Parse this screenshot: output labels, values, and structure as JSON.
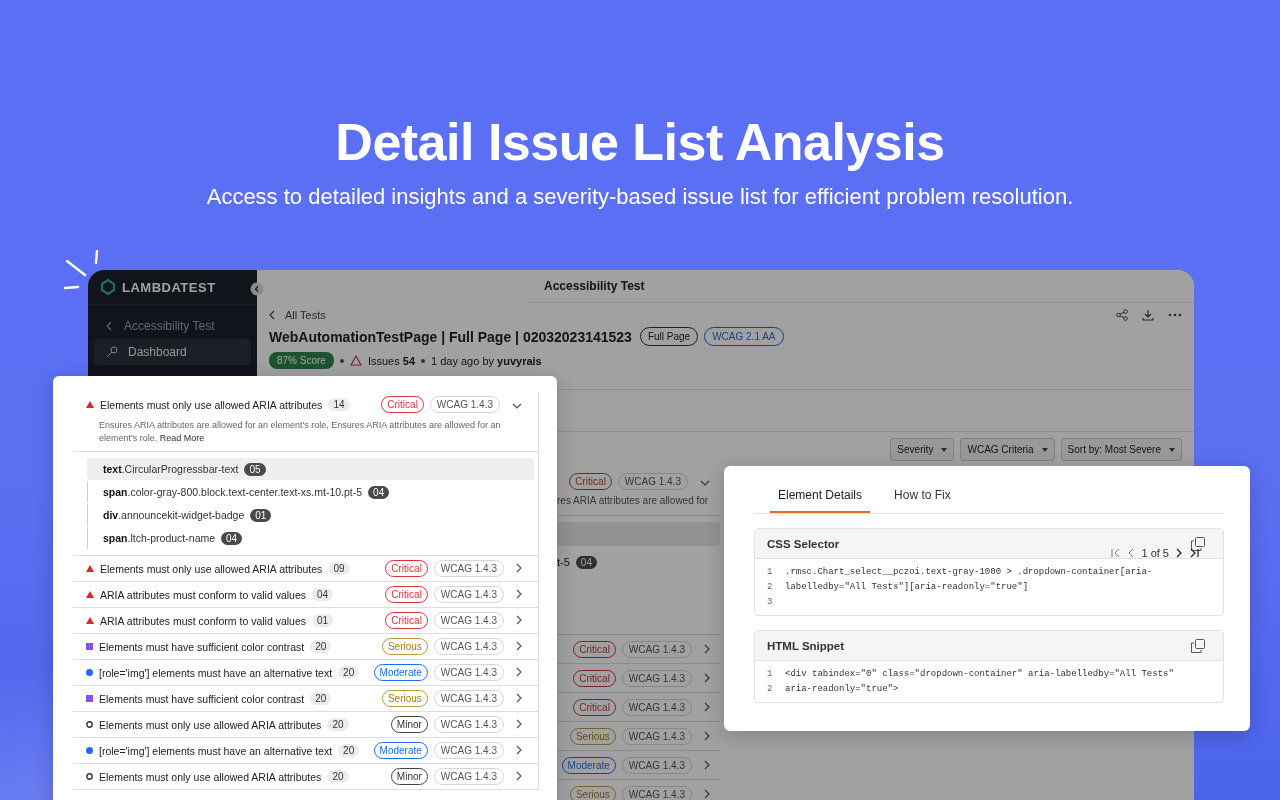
{
  "hero": {
    "title": "Detail Issue List Analysis",
    "subtitle": "Access to detailed insights and a severity-based issue list for efficient problem resolution."
  },
  "back_window": {
    "sidebar": {
      "logo": "LAMBDATEST",
      "back_label": "Accessibility Test",
      "items": [
        {
          "label": "Dashboard",
          "selected": true
        }
      ]
    },
    "header_title": "Accessibility Test",
    "breadcrumb": "All Tests",
    "test_title": "WebAutomationTestPage | Full Page | 02032023141523",
    "tags": [
      {
        "label": "Full Page",
        "kind": "neutral"
      },
      {
        "label": "WCAG 2.1 AA",
        "kind": "info"
      }
    ],
    "score": "87% Score",
    "issues_label": "Issues",
    "issues_count": "54",
    "meta": "1 day ago by",
    "author": "yuvyrais",
    "filters": [
      "Severity",
      "WCAG Criteria"
    ],
    "sort": {
      "label": "Sort by:",
      "value": "Most Severe"
    },
    "issues": [
      {
        "kind": "critical",
        "severity": "Critical",
        "wcag": "WCAG 1.4.3",
        "expanded": true,
        "description": "res ARIA attributes are allowed for",
        "children": [
          {
            "selected": true
          },
          {
            "selector": "t-5",
            "count": "04",
            "selected": false
          }
        ]
      },
      {
        "kind": "critical",
        "severity": "Critical",
        "wcag": "WCAG 1.4.3",
        "expanded": false
      },
      {
        "kind": "critical",
        "severity": "Critical",
        "wcag": "WCAG 1.4.3",
        "expanded": false
      },
      {
        "kind": "critical",
        "severity": "Critical",
        "wcag": "WCAG 1.4.3",
        "expanded": false
      },
      {
        "kind": "serious",
        "severity": "Serious",
        "wcag": "WCAG 1.4.3",
        "expanded": false
      },
      {
        "kind": "moderate",
        "severity": "Moderate",
        "wcag": "WCAG 1.4.3",
        "expanded": false
      },
      {
        "kind": "serious",
        "severity": "Serious",
        "wcag": "WCAG 1.4.3",
        "expanded": false
      }
    ]
  },
  "issue_panel": {
    "issues": [
      {
        "kind": "critical",
        "title": "Elements must only use allowed ARIA attributes",
        "count": "14",
        "severity": "Critical",
        "wcag": "WCAG 1.4.3",
        "expanded": true,
        "description": "Ensures ARIA attributes are allowed for an element's role, Ensures ARIA attributes are allowed for an element's role.",
        "read_more": "Read More",
        "children": [
          {
            "selector": "**text**.CircularProgressbar-text",
            "count": "05",
            "selected": true
          },
          {
            "selector": "**span**.color-gray-800.block.text-center.text-xs.mt-10.pt-5",
            "count": "04",
            "selected": false
          },
          {
            "selector": "**div**.announcekit-widget-badge",
            "count": "01",
            "selected": false
          },
          {
            "selector": "**span**.ltch-product-name",
            "count": "04",
            "selected": false
          }
        ]
      },
      {
        "kind": "critical",
        "title": "Elements must only use allowed ARIA attributes",
        "count": "09",
        "severity": "Critical",
        "wcag": "WCAG 1.4.3",
        "expanded": false
      },
      {
        "kind": "critical",
        "title": "ARIA attributes must conform to valid values",
        "count": "04",
        "severity": "Critical",
        "wcag": "WCAG 1.4.3",
        "expanded": false
      },
      {
        "kind": "critical",
        "title": "ARIA attributes must conform to valid values",
        "count": "01",
        "severity": "Critical",
        "wcag": "WCAG 1.4.3",
        "expanded": false
      },
      {
        "kind": "serious",
        "title": "Elements must have sufficient color contrast",
        "count": "20",
        "severity": "Serious",
        "wcag": "WCAG 1.4.3",
        "expanded": false
      },
      {
        "kind": "moderate",
        "title": "[role='img'] elements must have an alternative text",
        "count": "20",
        "severity": "Moderate",
        "wcag": "WCAG 1.4.3",
        "expanded": false
      },
      {
        "kind": "serious",
        "title": "Elements must have sufficient color contrast",
        "count": "20",
        "severity": "Serious",
        "wcag": "WCAG 1.4.3",
        "expanded": false
      },
      {
        "kind": "minor",
        "title": "Elements must only use allowed ARIA attributes",
        "count": "20",
        "severity": "Minor",
        "wcag": "WCAG 1.4.3",
        "expanded": false
      },
      {
        "kind": "moderate",
        "title": "[role='img'] elements must have an alternative text",
        "count": "20",
        "severity": "Moderate",
        "wcag": "WCAG 1.4.3",
        "expanded": false
      },
      {
        "kind": "minor",
        "title": "Elements must only use allowed ARIA attributes",
        "count": "20",
        "severity": "Minor",
        "wcag": "WCAG 1.4.3",
        "expanded": false
      }
    ]
  },
  "details_panel": {
    "tabs": [
      {
        "label": "Element Details",
        "selected": true
      },
      {
        "label": "How to Fix",
        "selected": false
      }
    ],
    "sections": [
      {
        "title": "CSS Selector",
        "pager": "1 of 5",
        "lines": [
          {
            "number": "1",
            "code": ".rmsc.Chart_select__pczoi.text-gray-1000 > .dropdown-container[aria-"
          },
          {
            "number": "2",
            "code": "labelledby=\"All Tests\"][aria-readonly=\"true\"]"
          },
          {
            "number": "3"
          }
        ]
      },
      {
        "title": "HTML Snippet",
        "lines": [
          {
            "number": "1",
            "code": "<div tabindex=\"0\" class=\"dropdown-container\" aria-labelledby=\"All Tests\""
          },
          {
            "number": "2",
            "code": "aria-readonly=\"true\">"
          }
        ]
      }
    ]
  }
}
